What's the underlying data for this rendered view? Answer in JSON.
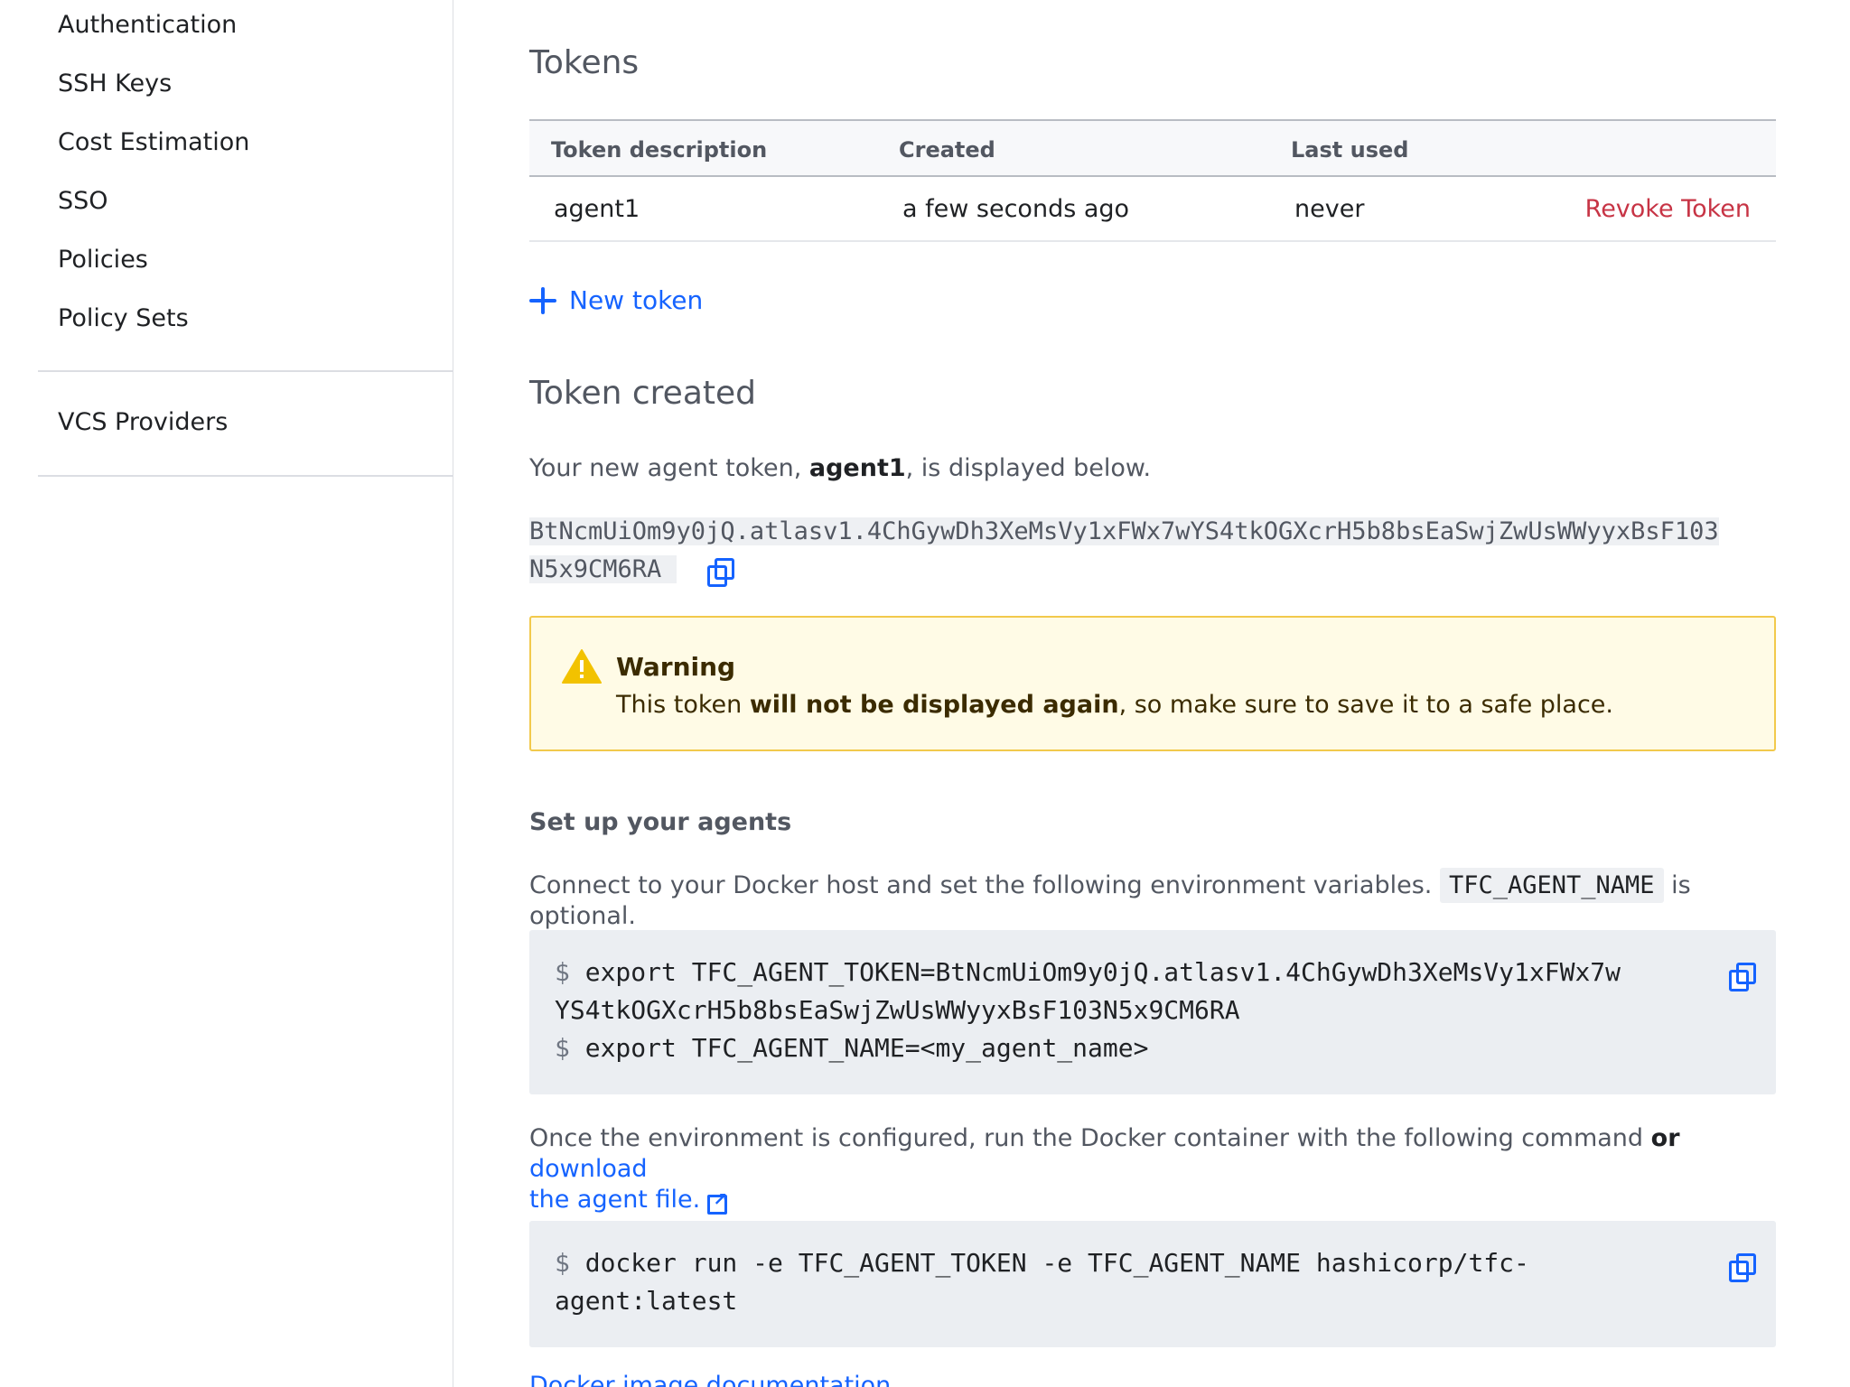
{
  "sidebar": {
    "items": [
      {
        "label": "Authentication"
      },
      {
        "label": "SSH Keys"
      },
      {
        "label": "Cost Estimation"
      },
      {
        "label": "SSO"
      },
      {
        "label": "Policies"
      },
      {
        "label": "Policy Sets"
      },
      {
        "label": "VCS Providers"
      }
    ]
  },
  "tokens": {
    "title": "Tokens",
    "columns": [
      "Token description",
      "Created",
      "Last used"
    ],
    "rows": [
      {
        "description": "agent1",
        "created": "a few seconds ago",
        "last_used": "never",
        "action": "Revoke Token"
      }
    ],
    "new_token_label": "New token"
  },
  "token_created": {
    "title": "Token created",
    "intro_before": "Your new agent token, ",
    "intro_name": "agent1",
    "intro_after": ", is displayed below.",
    "token_line1": "BtNcmUiOm9y0jQ.atlasv1.4ChGywDh3XeMsVy1xFWx7wYS4tkOGXcrH5b8bsEaSwjZwUsWWyyxBsF103",
    "token_line2": "N5x9CM6RA"
  },
  "warning": {
    "title": "Warning",
    "text_before": "This token ",
    "text_bold": "will not be displayed again",
    "text_after": ", so make sure to save it to a safe place."
  },
  "setup": {
    "title": "Set up your agents",
    "env_before": "Connect to your Docker host and set the following environment variables.",
    "env_code": "TFC_AGENT_NAME",
    "env_after": "is optional.",
    "code1": {
      "prompt": "$",
      "line1": "export TFC_AGENT_TOKEN=BtNcmUiOm9y0jQ.atlasv1.4ChGywDh3XeMsVy1xFWx7w",
      "line2": "YS4tkOGXcrH5b8bsEaSwjZwUsWWyyxBsF103N5x9CM6RA",
      "line3": "export TFC_AGENT_NAME=<my_agent_name>"
    },
    "run_before": "Once the environment is configured, run the Docker container with the following command ",
    "run_or": "or",
    "run_link1": "download",
    "run_link2": "the agent file.",
    "code2": {
      "prompt": "$",
      "line1": "docker run -e TFC_AGENT_TOKEN -e TFC_AGENT_NAME hashicorp/tfc-",
      "line2": "agent:latest"
    },
    "docs_link": "Docker image documentation"
  },
  "colors": {
    "link": "#1563ff",
    "danger": "#c73445",
    "warning_bg": "#fffbe6",
    "warning_border": "#f2c94c"
  },
  "icons": [
    "plus-icon",
    "copy-icon",
    "warning-icon",
    "external-link-icon"
  ]
}
